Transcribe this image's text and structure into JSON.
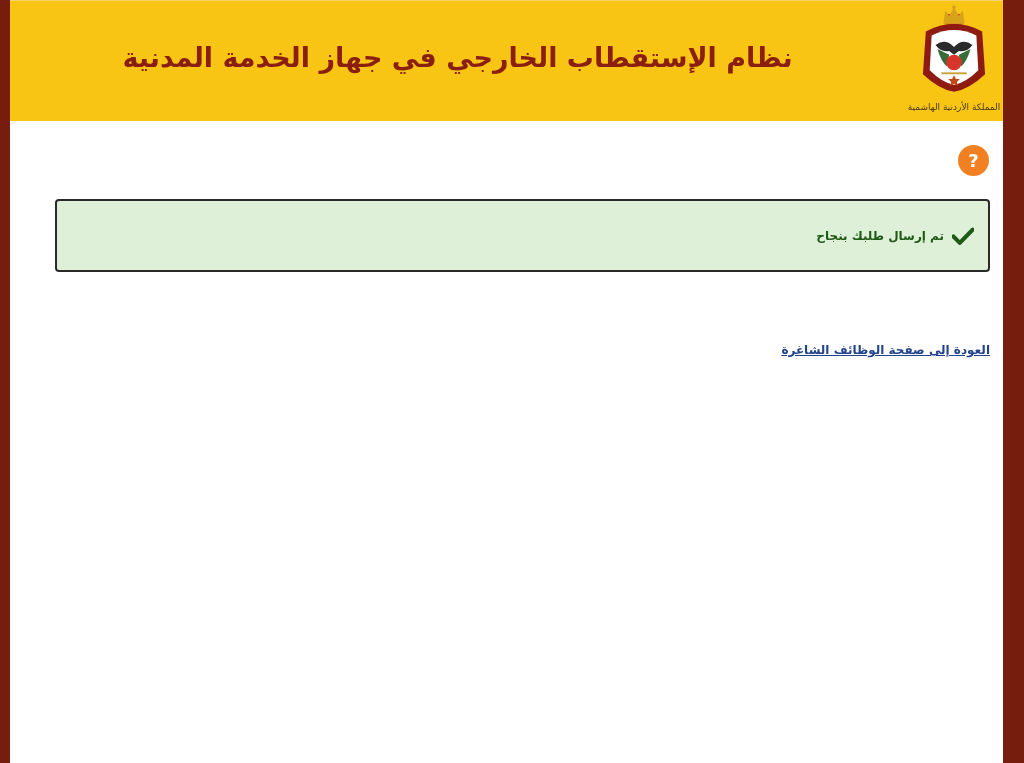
{
  "header": {
    "title": "نظام الإستقطاب الخارجي في جهاز الخدمة المدنية",
    "emblem_caption": "المملكة الأردنية الهاشمية"
  },
  "help_button": {
    "label": "?"
  },
  "alert": {
    "kind": "success",
    "message": "تم إرسال طلبك بنجاح"
  },
  "back_link": {
    "label": "العودة إلى صفحة الوظائف الشاغرة"
  }
}
